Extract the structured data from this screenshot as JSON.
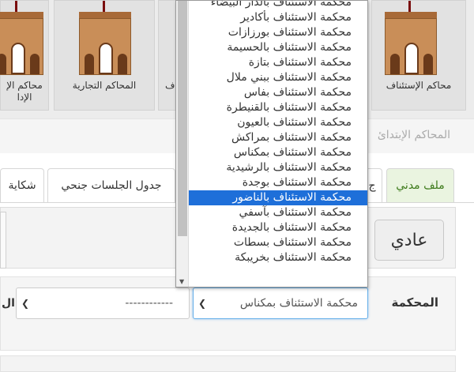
{
  "tiles": [
    {
      "label_line1": "محاكم الإ",
      "label_line2": "الإدا"
    },
    {
      "label_line1": "المحاكم التجارية",
      "label_line2": ""
    },
    {
      "label_line1": "ف",
      "label_line2": ""
    },
    {
      "label_line1": "محاكم الإستئناف",
      "label_line2": ""
    }
  ],
  "section_title": "المحاكم الإبتدائ",
  "tabs": [
    {
      "label": "ملف مدني"
    },
    {
      "label": "ج"
    },
    {
      "label": "جدول الجلسات جنحي"
    },
    {
      "label": "شكاية"
    }
  ],
  "normal_button": "عادي",
  "form": {
    "court_label": "المحكمة",
    "court_select_value": "محكمة الاستئناف بمكناس",
    "second_select_value": "------------",
    "edge_label": "ال"
  },
  "dropdown": {
    "selected_index": 13,
    "items": [
      "محكمة الاستئناف بالدار البيضاء",
      "محكمة الاستئناف بأكادير",
      "محكمة الاستئناف بورزازات",
      "محكمة الاستئناف بالحسيمة",
      "محكمة الاستئناف بتازة",
      "محكمة الاستئناف ببني ملال",
      "محكمة الاستئناف بفاس",
      "محكمة الاستئناف بالقنيطرة",
      "محكمة الاستئناف بالعيون",
      "محكمة الاستئناف بمراكش",
      "محكمة الاستئناف بمكناس",
      "محكمة الاستئناف بالرشيدية",
      "محكمة الاستئناف بوجدة",
      "محكمة الاستئناف بالناضور",
      "محكمة الاستئناف بآسفي",
      "محكمة الاستئناف بالجديدة",
      "محكمة الاستئناف بسطات",
      "محكمة الاستئناف بخريبكة"
    ]
  }
}
